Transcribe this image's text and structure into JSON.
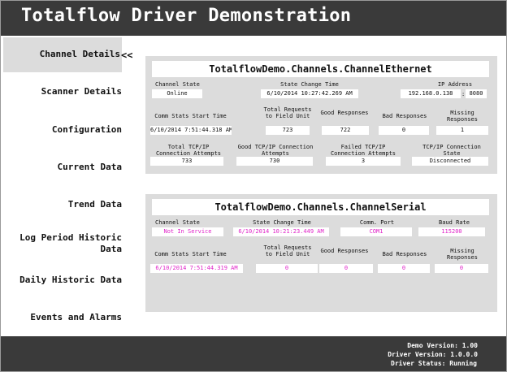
{
  "header": {
    "title": "Totalflow Driver Demonstration"
  },
  "sidebar": {
    "active_marker": "<<",
    "items": [
      {
        "label": "Channel Details"
      },
      {
        "label": "Scanner Details"
      },
      {
        "label": "Configuration"
      },
      {
        "label": "Current Data"
      },
      {
        "label": "Trend Data"
      },
      {
        "label": "Log Period Historic Data"
      },
      {
        "label": "Daily Historic Data"
      },
      {
        "label": "Events and Alarms"
      }
    ]
  },
  "ethernet": {
    "title": "TotalflowDemo.Channels.ChannelEthernet",
    "channel_state_label": "Channel State",
    "channel_state": "Online",
    "state_change_label": "State Change Time",
    "state_change": "6/10/2014 10:27:42.269 AM",
    "ip_label": "IP Address",
    "ip": "192.168.0.138",
    "port": "8080",
    "port_sep": ":",
    "comm_start_label": "Comm Stats Start Time",
    "comm_start": "6/10/2014 7:51:44.318 AM",
    "total_req_label": "Total Requests to Field Unit",
    "total_req": "723",
    "good_label": "Good Responses",
    "good": "722",
    "bad_label": "Bad Responses",
    "bad": "0",
    "missing_label": "Missing Responses",
    "missing": "1",
    "tcp_total_label": "Total TCP/IP Connection Attempts",
    "tcp_total": "733",
    "tcp_good_label": "Good TCP/IP Connection Attempts",
    "tcp_good": "730",
    "tcp_failed_label": "Failed TCP/IP Connection Attempts",
    "tcp_failed": "3",
    "tcp_state_label": "TCP/IP Connection State",
    "tcp_state": "Disconnected"
  },
  "serial": {
    "title": "TotalflowDemo.Channels.ChannelSerial",
    "channel_state_label": "Channel State",
    "channel_state": "Not In Service",
    "state_change_label": "State Change Time",
    "state_change": "6/10/2014 10:21:23.449 AM",
    "port_label": "Comm. Port",
    "port": "COM1",
    "baud_label": "Baud Rate",
    "baud": "115200",
    "comm_start_label": "Comm Stats Start Time",
    "comm_start": "6/10/2014 7:51:44.319 AM",
    "total_req_label": "Total Requests to Field Unit",
    "total_req": "0",
    "good_label": "Good Responses",
    "good": "0",
    "bad_label": "Bad Responses",
    "bad": "0",
    "missing_label": "Missing Responses",
    "missing": "0"
  },
  "footer": {
    "demo_version_label": "Demo Version:",
    "demo_version": "1.00",
    "driver_version_label": "Driver Version:",
    "driver_version": "1.0.0.0",
    "driver_status_label": "Driver Status:",
    "driver_status": "Running"
  }
}
